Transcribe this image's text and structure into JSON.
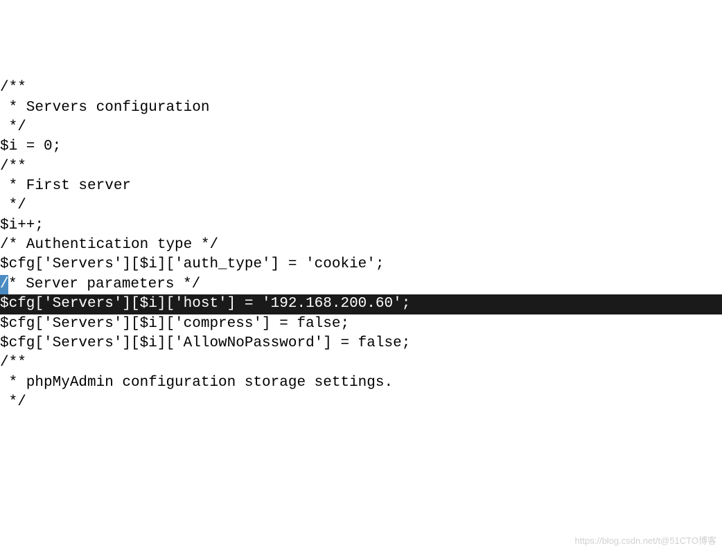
{
  "code": {
    "lines": [
      "/**",
      " * Servers configuration",
      " */",
      "$i = 0;",
      "",
      "/**",
      " * First server",
      " */",
      "$i++;",
      "/* Authentication type */",
      "$cfg['Servers'][$i]['auth_type'] = 'cookie';",
      "* Server parameters */",
      "$cfg['Servers'][$i]['host'] = '192.168.200.60';",
      "$cfg['Servers'][$i]['compress'] = false;",
      "$cfg['Servers'][$i]['AllowNoPassword'] = false;",
      "",
      "/**",
      " * phpMyAdmin configuration storage settings.",
      " */"
    ],
    "highlighted_index": 12,
    "cursor_line_index": 11,
    "cursor_char": "/"
  },
  "watermark": "https://blog.csdn.net/t@51CTO博客"
}
